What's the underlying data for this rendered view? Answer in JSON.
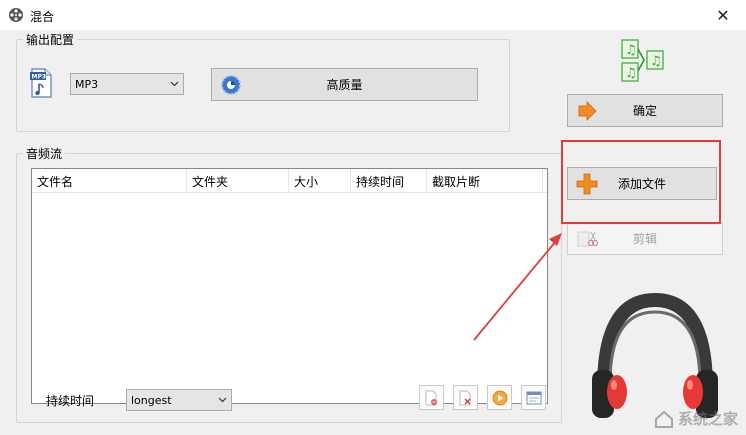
{
  "window": {
    "title": "混合",
    "close_glyph": "✕"
  },
  "output": {
    "group_label": "输出配置",
    "format_selected": "MP3",
    "format_icon_text": "MP3",
    "quality_label": "高质量"
  },
  "actions": {
    "confirm_label": "确定",
    "add_file_label": "添加文件",
    "trim_label": "剪辑"
  },
  "audio_stream": {
    "group_label": "音频流",
    "columns": [
      "文件名",
      "文件夹",
      "大小",
      "持续时间",
      "截取片断"
    ],
    "rows": []
  },
  "duration": {
    "label": "持续时间",
    "selected": "longest"
  },
  "watermark": "系统之家",
  "colors": {
    "highlight": "#e23b3b",
    "accent_orange": "#f08c22",
    "music_green": "#3aa53a"
  },
  "icons": {
    "music_merge": "music-merge-icon",
    "confirm": "arrow-right-icon",
    "add": "plus-icon",
    "trim": "scissors-icon",
    "quality": "quality-gear-icon"
  }
}
